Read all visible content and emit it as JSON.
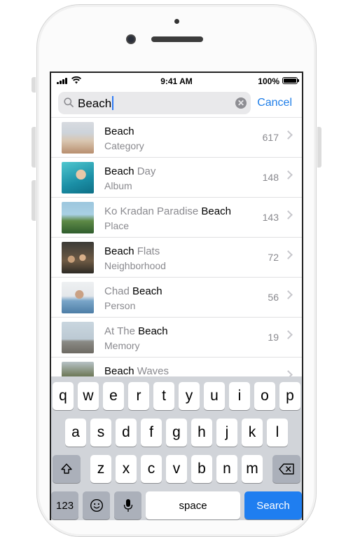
{
  "status_bar": {
    "time": "9:41 AM",
    "battery": "100%"
  },
  "search": {
    "query": "Beach",
    "cancel_label": "Cancel"
  },
  "results": [
    {
      "title_plain": "",
      "title_bold": "Beach",
      "title_rest": "",
      "subtitle": "Category",
      "count": "617"
    },
    {
      "title_plain": "",
      "title_bold": "Beach",
      "title_rest": " Day",
      "subtitle": "Album",
      "count": "148"
    },
    {
      "title_plain": "Ko Kradan Paradise ",
      "title_bold": "Beach",
      "title_rest": "",
      "subtitle": "Place",
      "count": "143"
    },
    {
      "title_plain": "",
      "title_bold": "Beach",
      "title_rest": " Flats",
      "subtitle": "Neighborhood",
      "count": "72"
    },
    {
      "title_plain": "Chad ",
      "title_bold": "Beach",
      "title_rest": "",
      "subtitle": "Person",
      "count": "56"
    },
    {
      "title_plain": "At The ",
      "title_bold": "Beach",
      "title_rest": "",
      "subtitle": "Memory",
      "count": "19"
    },
    {
      "title_plain": "",
      "title_bold": "Beach",
      "title_rest": " Waves",
      "subtitle": "",
      "count": ""
    }
  ],
  "keyboard": {
    "row1": [
      "q",
      "w",
      "e",
      "r",
      "t",
      "y",
      "u",
      "i",
      "o",
      "p"
    ],
    "row2": [
      "a",
      "s",
      "d",
      "f",
      "g",
      "h",
      "j",
      "k",
      "l"
    ],
    "row3": [
      "z",
      "x",
      "c",
      "v",
      "b",
      "n",
      "m"
    ],
    "numbers_label": "123",
    "space_label": "space",
    "search_label": "Search"
  },
  "icons": {
    "shift": "shift-icon",
    "delete": "delete-icon",
    "emoji": "emoji-icon",
    "mic": "microphone-icon",
    "search": "search-icon",
    "clear": "clear-icon",
    "chevron": "chevron-right-icon"
  },
  "colors": {
    "accent": "#1f7ee8",
    "keyboard_bg": "#d1d4d9"
  }
}
